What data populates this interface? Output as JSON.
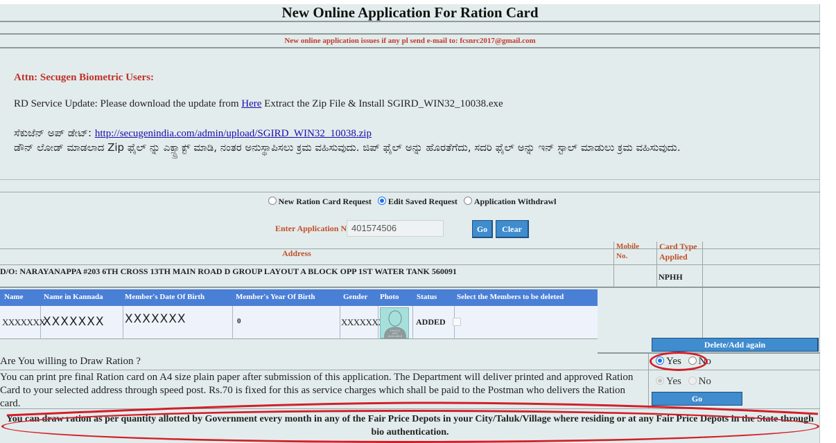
{
  "header": {
    "title": "New Online Application For Ration Card",
    "notice": "New online application issues if any pl send e-mail to: fcsnrc2017@gmail.com"
  },
  "biometric": {
    "attn": "Attn: Secugen Biometric Users:",
    "rd_prefix": "RD Service Update: Please download the update from",
    "rd_link": "Here",
    "rd_suffix": "Extract the Zip File & Install SGIRD_WIN32_10038.exe",
    "kn_update_label": "ಸೆಕುಜೆನ್ ಅಪ್ ಡೇಟ್:",
    "kn_update_link": "http://secugenindia.com/admin/upload/SGIRD_WIN32_10038.zip",
    "kn_instructions": "ಡೌನ್ ಲೋಡ್ ಮಾಡಲಾದ Zip ಫೈಲ್ ನ್ನು ಎಕ್ಸ್ಟ್ರಾಕ್ಟ್ ಮಾಡಿ, ನಂತರ ಅನುಸ್ಥಾಪಿಸಲು ಕ್ರಮ ವಹಿಸುವುದು. ಜಿಪ್ ಫೈಲ್ ಅನ್ನು ಹೊರತೆಗೆದು, ಸದರಿ ಫೈಲ್ ಅನ್ನು ಇನ್ ಸ್ಟಾಲ್ ಮಾಡುಲು ಕ್ರಮ ವಹಿಸುವುದು."
  },
  "request": {
    "options": [
      {
        "label": "New Ration Card Request",
        "selected": false
      },
      {
        "label": "Edit Saved Request",
        "selected": true
      },
      {
        "label": "Application Withdrawl",
        "selected": false
      }
    ],
    "app_no_label": "Enter Application No.",
    "app_no_value": "401574506",
    "go_label": "Go",
    "clear_label": "Clear"
  },
  "address": {
    "header": "Address",
    "mobile_header": "Mobile No.",
    "card_type_header": "Card Type Applied",
    "value": "D/O: NARAYANAPPA #203 6TH CROSS 13TH MAIN ROAD D GROUP LAYOUT A BLOCK OPP 1ST WATER TANK 560091",
    "mobile": "",
    "card_type": "NPHH"
  },
  "members": {
    "columns": [
      "Name",
      "Name in Kannada",
      "Member's Date Of Birth",
      "Member's Year Of Birth",
      "Gender",
      "Photo",
      "Status",
      "Select the Members to be deleted"
    ],
    "rows": [
      {
        "name": "XXXXXXX",
        "name_kannada": "XXXXXXX",
        "dob": "XXXXXXX",
        "yob": "0",
        "gender": "XXXXXXX",
        "photo": "PHOTO NOT AVAILABLE",
        "status": "ADDED",
        "selected": false
      }
    ],
    "delete_label": "Delete/Add again"
  },
  "draw_ration": {
    "question": "Are You willing to Draw Ration ?",
    "yes": "Yes",
    "no": "No",
    "selected": "Yes"
  },
  "print_card": {
    "text": "You can print pre final Ration card on A4 size plain paper after submission of this application. The Department will deliver printed and approved Ration Card to your selected address through speed post. Rs.70 is fixed for this as service charges which shall be paid to the Postman who delivers the Ration card.",
    "yes": "Yes",
    "no": "No",
    "go_label": "Go"
  },
  "footer": {
    "ration_note": "You can draw ration as per quantity allotted by Government every month in any of the Fair Price Depots in your City/Taluk/Village where residing or at any Fair Price Depots in the State through bio authentication."
  },
  "colors": {
    "page_bg": "#e3ecec",
    "accent_red": "#c0302a",
    "button_blue": "#3f8ccf",
    "table_header_blue": "#4a7fd6",
    "annotation_red": "#d11f2a"
  }
}
